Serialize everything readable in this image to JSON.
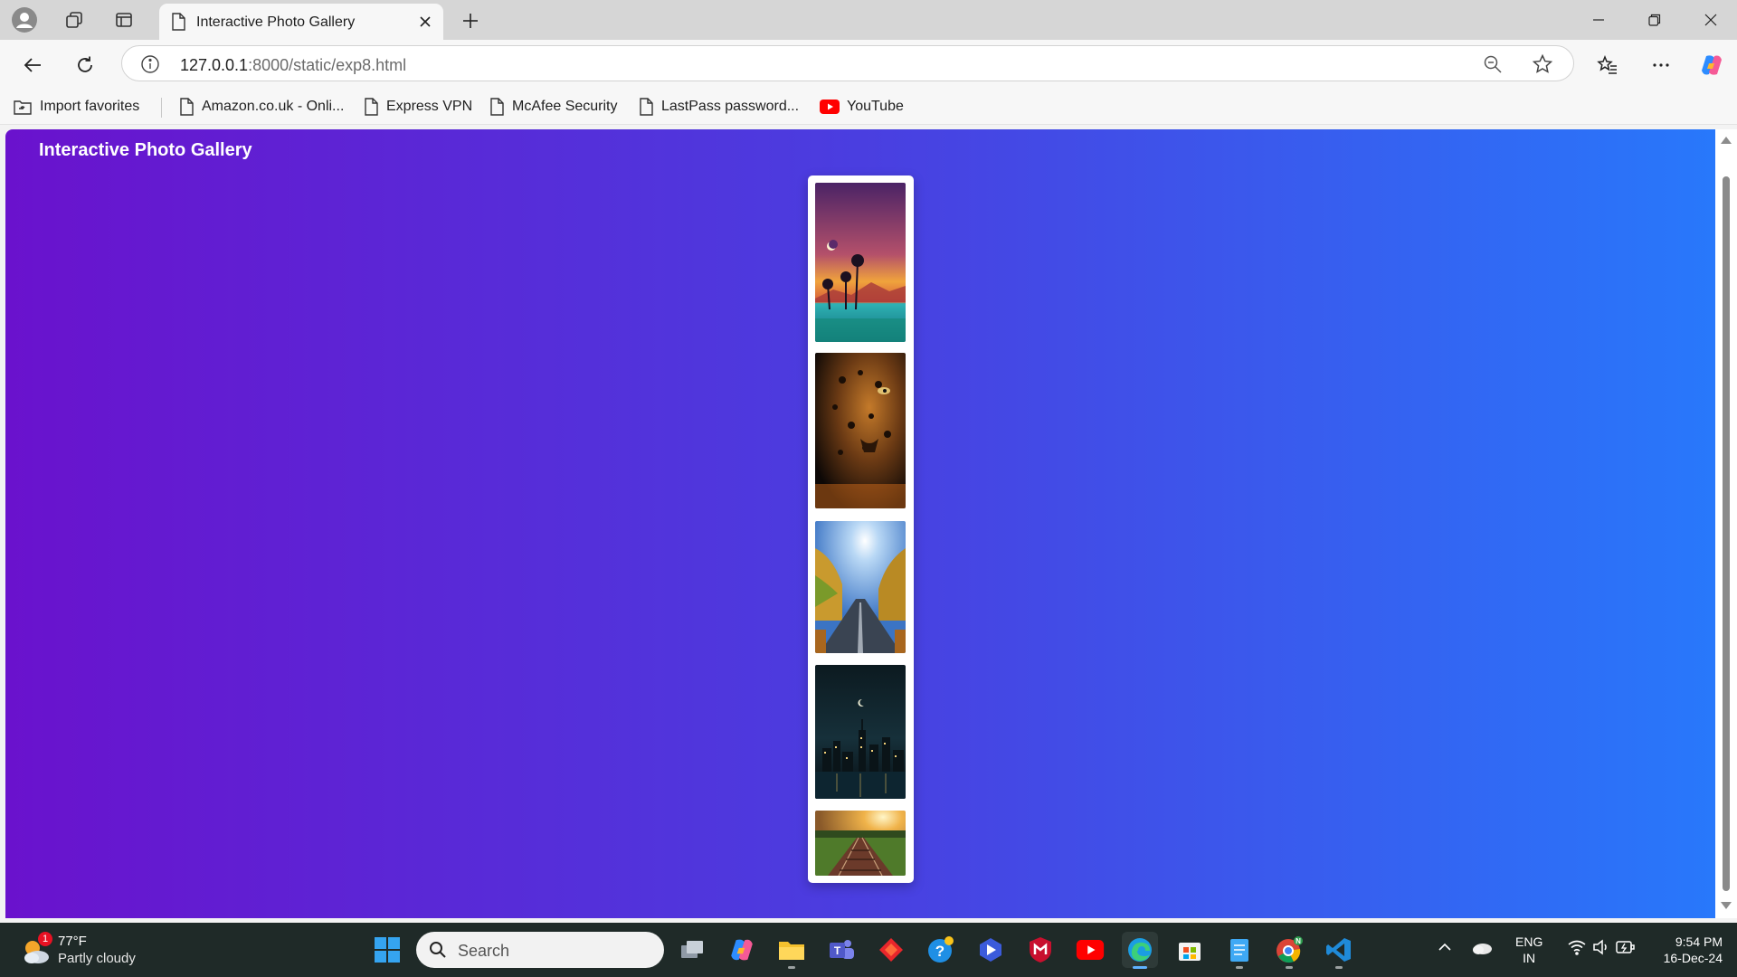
{
  "browser": {
    "tab_title": "Interactive Photo Gallery",
    "url_host": "127.0.0.1",
    "url_rest": ":8000/static/exp8.html"
  },
  "favorites": [
    {
      "label": "Import favorites",
      "icon": "import-favorites-icon"
    },
    {
      "label": "Amazon.co.uk - Onli...",
      "icon": "page-icon"
    },
    {
      "label": "Express VPN",
      "icon": "page-icon"
    },
    {
      "label": "McAfee Security",
      "icon": "page-icon"
    },
    {
      "label": "LastPass password...",
      "icon": "page-icon"
    },
    {
      "label": "YouTube",
      "icon": "youtube-icon"
    }
  ],
  "page": {
    "title": "Interactive Photo Gallery",
    "background": {
      "from": "#6a12cd",
      "to": "#2878fb"
    },
    "photos": [
      {
        "name": "sunset-palm-trees",
        "colors": [
          "#5b2a6b",
          "#e2843a",
          "#1fa3a8"
        ]
      },
      {
        "name": "leopard-closeup",
        "colors": [
          "#2b1a10",
          "#b36a22",
          "#0d0a08"
        ]
      },
      {
        "name": "autumn-road-sun",
        "colors": [
          "#3f7ac9",
          "#c9a33a",
          "#3b4a5a"
        ]
      },
      {
        "name": "night-city-skyline",
        "colors": [
          "#0d1a22",
          "#1c3440",
          "#0a0f14"
        ]
      },
      {
        "name": "railway-sunset",
        "colors": [
          "#d9a24a",
          "#4f7a2a",
          "#6b3a2a"
        ]
      }
    ]
  },
  "taskbar": {
    "weather_temp": "77°F",
    "weather_desc": "Partly cloudy",
    "weather_badge": "1",
    "search_placeholder": "Search",
    "lang_line1": "ENG",
    "lang_line2": "IN",
    "time": "9:54 PM",
    "date": "16-Dec-24"
  }
}
